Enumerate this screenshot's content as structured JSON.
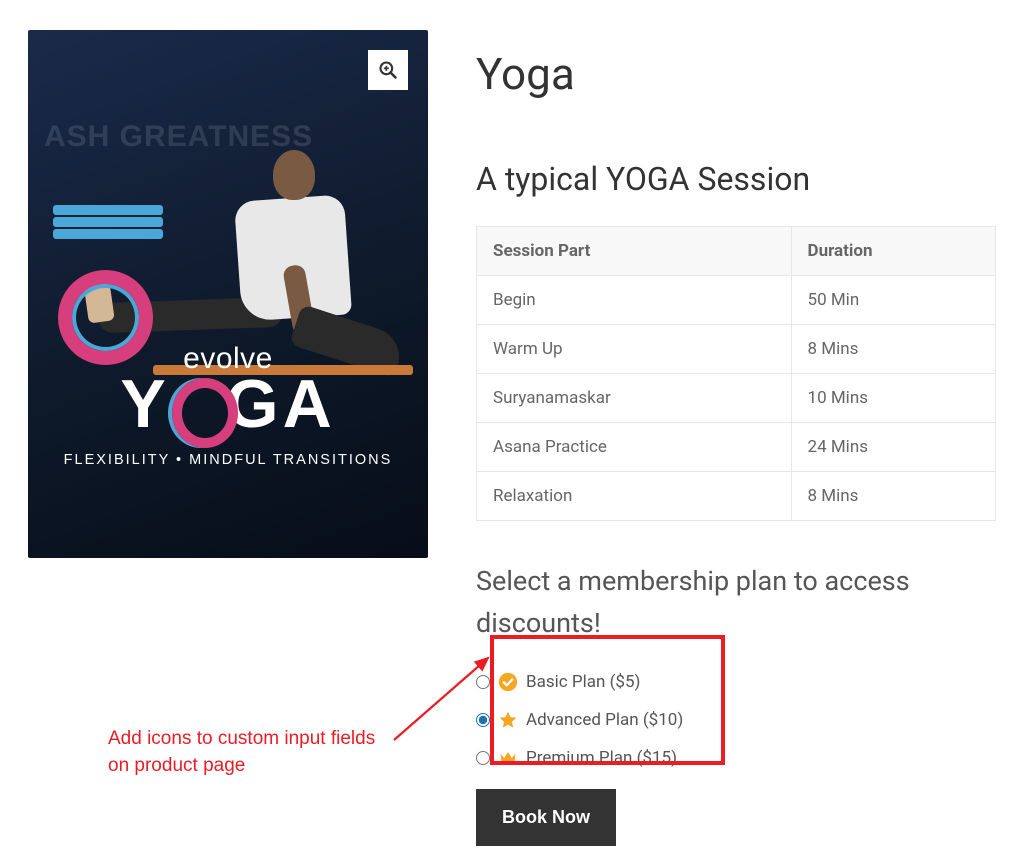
{
  "product": {
    "title": "Yoga",
    "image": {
      "wall_text": "ASH GREATNESS",
      "logo_small": "evolve",
      "logo_big_part1": "Y",
      "logo_big_part2": "GA",
      "tagline": "FLEXIBILITY • MINDFUL TRANSITIONS"
    }
  },
  "session": {
    "heading": "A typical YOGA Session",
    "columns": [
      "Session Part",
      "Duration"
    ],
    "rows": [
      {
        "part": "Begin",
        "duration": "50 Min"
      },
      {
        "part": "Warm Up",
        "duration": "8 Mins"
      },
      {
        "part": "Suryanamaskar",
        "duration": "10 Mins"
      },
      {
        "part": "Asana Practice",
        "duration": "24 Mins"
      },
      {
        "part": "Relaxation",
        "duration": "8 Mins"
      }
    ]
  },
  "membership": {
    "heading": "Select a membership plan to access discounts!",
    "plans": [
      {
        "label": "Basic Plan ($5)",
        "icon": "check-circle",
        "checked": false
      },
      {
        "label": "Advanced Plan ($10)",
        "icon": "star",
        "checked": true
      },
      {
        "label": "Premium Plan ($15)",
        "icon": "crown",
        "checked": false
      }
    ],
    "button": "Book Now"
  },
  "annotation": {
    "text_line1": "Add icons to custom input fields",
    "text_line2": "on product page"
  }
}
